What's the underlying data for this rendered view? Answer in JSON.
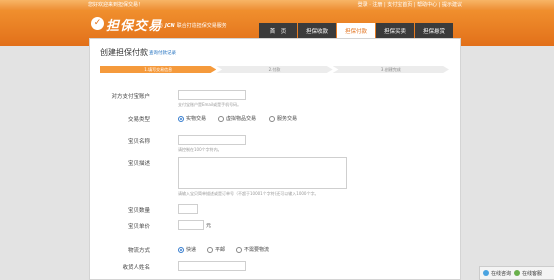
{
  "topbar": {
    "welcome": "您好欢迎来到担保交易！",
    "links": "登录 · 注册 | 支付宝首页 | 帮助中心 | 提示建议"
  },
  "logo": {
    "text": "担保交易",
    "partner_prefix": "与",
    "partner_brand": "JCN",
    "partner_suffix": "联合打造担保交易服务"
  },
  "nav": [
    {
      "label": "首　页",
      "active": false
    },
    {
      "label": "担保收款",
      "active": false
    },
    {
      "label": "担保付款",
      "active": true
    },
    {
      "label": "担保买卖",
      "active": false
    },
    {
      "label": "担保悬赏",
      "active": false
    }
  ],
  "page": {
    "title": "创建担保付款",
    "subtitle": "查询付款记录"
  },
  "steps": [
    {
      "label": "1.填写交易信息",
      "active": true
    },
    {
      "label": "2.付款",
      "active": false
    },
    {
      "label": "3.创建完成",
      "active": false
    }
  ],
  "form": {
    "account": {
      "label": "对方支付宝账户",
      "hint": "支付宝账户是Email或是手机号码。"
    },
    "type": {
      "label": "交易类型",
      "options": [
        {
          "label": "实物交易",
          "checked": true
        },
        {
          "label": "虚拟物品交易",
          "checked": false
        },
        {
          "label": "服务交易",
          "checked": false
        }
      ]
    },
    "name": {
      "label": "宝贝名称",
      "hint": "请控制在100个字符内。"
    },
    "desc": {
      "label": "宝贝描述",
      "hint": "请输入宝贝简单描述或是订单号（不超于10001个字符)还可以输入1000个字。"
    },
    "qty": {
      "label": "宝贝数量"
    },
    "price": {
      "label": "宝贝单价",
      "unit": "元"
    },
    "shipping": {
      "label": "物流方式",
      "options": [
        {
          "label": "快递",
          "checked": true
        },
        {
          "label": "平邮",
          "checked": false
        },
        {
          "label": "不需要物流",
          "checked": false
        }
      ]
    },
    "receiver": {
      "label": "收货人姓名"
    }
  },
  "chat": {
    "item1": "在线咨询",
    "item2": "在线客服"
  }
}
